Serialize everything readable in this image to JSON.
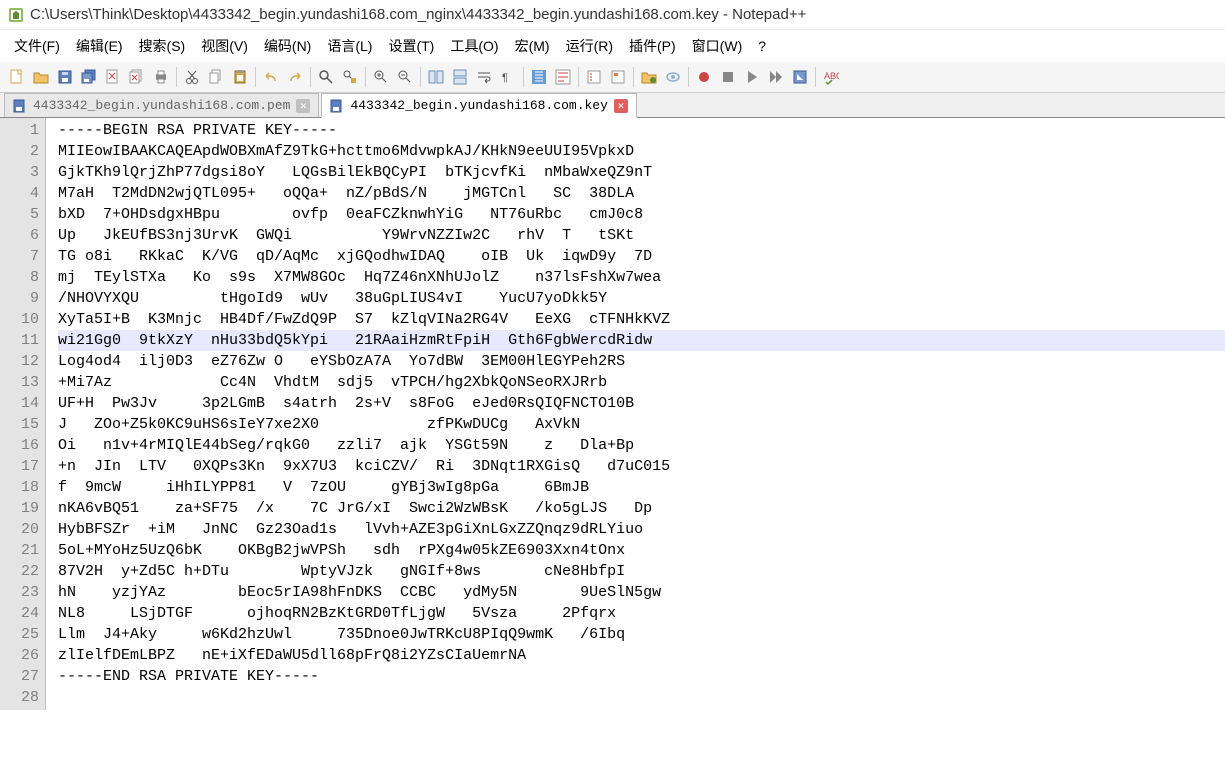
{
  "window": {
    "title": "C:\\Users\\Think\\Desktop\\4433342_begin.yundashi168.com_nginx\\4433342_begin.yundashi168.com.key - Notepad++"
  },
  "menu": {
    "items": [
      {
        "label": "文件(F)",
        "name": "menu-file"
      },
      {
        "label": "编辑(E)",
        "name": "menu-edit"
      },
      {
        "label": "搜索(S)",
        "name": "menu-search"
      },
      {
        "label": "视图(V)",
        "name": "menu-view"
      },
      {
        "label": "编码(N)",
        "name": "menu-encoding"
      },
      {
        "label": "语言(L)",
        "name": "menu-language"
      },
      {
        "label": "设置(T)",
        "name": "menu-settings"
      },
      {
        "label": "工具(O)",
        "name": "menu-tools"
      },
      {
        "label": "宏(M)",
        "name": "menu-macro"
      },
      {
        "label": "运行(R)",
        "name": "menu-run"
      },
      {
        "label": "插件(P)",
        "name": "menu-plugins"
      },
      {
        "label": "窗口(W)",
        "name": "menu-window"
      },
      {
        "label": "?",
        "name": "menu-help"
      }
    ]
  },
  "tabs": [
    {
      "label": "4433342_begin.yundashi168.com.pem",
      "active": false,
      "name": "tab-pem"
    },
    {
      "label": "4433342_begin.yundashi168.com.key",
      "active": true,
      "name": "tab-key"
    }
  ],
  "editor": {
    "selected_line": 11,
    "lines": [
      "-----BEGIN RSA PRIVATE KEY-----",
      "MIIEowIBAAKCAQEApdWOBXmAfZ9TkG+hcttmo6MdvwpkAJ/KHkN9eeUUI95VpkxD",
      "GjkTKh9lQrjZhP77dgsi8oY   LQGsBilEkBQCyPI  bTKjcvfKi  nMbaWxeQZ9nT",
      "M7aH  T2MdDN2wjQTL095+   oQQa+  nZ/pBdS/N    jMGTCnl   SC  38DLA",
      "bXD  7+OHDsdgxHBpu        ovfp  0eaFCZknwhYiG   NT76uRbc   cmJ0c8",
      "Up   JkEUfBS3nj3UrvK  GWQi          Y9WrvNZZIw2C   rhV  T   tSKt",
      "TG o8i   RKkaC  K/VG  qD/AqMc  xjGQodhwIDAQ    oIB  Uk  iqwD9y  7D",
      "mj  TEylSTXa   Ko  s9s  X7MW8GOc  Hq7Z46nXNhUJolZ    n37lsFshXw7wea",
      "/NHOVYXQU         tHgoId9  wUv   38uGpLIUS4vI    YucU7yoDkk5Y",
      "XyTa5I+B  K3Mnjc  HB4Df/FwZdQ9P  S7  kZlqVINa2RG4V   EeXG  cTFNHkKVZ",
      "wi21Gg0  9tkXzY  nHu33bdQ5kYpi   21RAaiHzmRtFpiH  Gth6FgbWercdRidw",
      "Log4od4  ilj0D3  eZ76Zw O   eYSbOzA7A  Yo7dBW  3EM00HlEGYPeh2RS",
      "+Mi7Az            Cc4N  VhdtM  sdj5  vTPCH/hg2XbkQoNSeoRXJRrb",
      "UF+H  Pw3Jv     3p2LGmB  s4atrh  2s+V  s8FoG  eJed0RsQIQFNCTO10B",
      "J   ZOo+Z5k0KC9uHS6sIeY7xe2X0            zfPKwDUCg   AxVkN",
      "Oi   n1v+4rMIQlE44bSeg/rqkG0   zzli7  ajk  YSGt59N    z   Dla+Bp",
      "+n  JIn  LTV   0XQPs3Kn  9xX7U3  kciCZV/  Ri  3DNqt1RXGisQ   d7uC015",
      "f  9mcW     iHhILYPP81   V  7zOU     gYBj3wIg8pGa     6BmJB",
      "nKA6vBQ51    za+SF75  /x    7C JrG/xI  Swci2WzWBsK   /ko5gLJS   Dp",
      "HybBFSZr  +iM   JnNC  Gz23Oad1s   lVvh+AZE3pGiXnLGxZZQnqz9dRLYiuo",
      "5oL+MYoHz5UzQ6bK    OKBgB2jwVPSh   sdh  rPXg4w05kZE6903Xxn4tOnx",
      "87V2H  y+Zd5C h+DTu        WptyVJzk   gNGIf+8ws       cNe8HbfpI",
      "hN    yzjYAz        bEoc5rIA98hFnDKS  CCBC   ydMy5N       9UeSlN5gw",
      "NL8     LSjDTGF      ojhoqRN2BzKtGRD0TfLjgW   5Vsza     2Pfqrx",
      "Llm  J4+Aky     w6Kd2hzUwl     735Dnoe0JwTRKcU8PIqQ9wmK   /6Ibq",
      "zlIelfDEmLBPZ   nE+iXfEDaWU5dll68pFrQ8i2YZsCIaUemrNA",
      "-----END RSA PRIVATE KEY-----",
      ""
    ]
  }
}
